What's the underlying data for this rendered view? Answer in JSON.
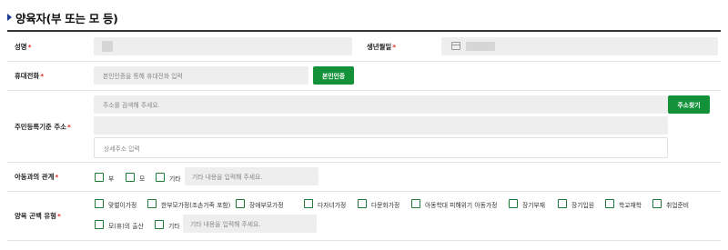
{
  "section": {
    "title": "양육자(부 또는 모 등)",
    "marker_icon": "triangle-right-icon",
    "marker_color": "#1a3a8f"
  },
  "fields": {
    "name": {
      "label": "성명",
      "required_mark": "*"
    },
    "birth": {
      "label": "생년월일",
      "required_mark": "*",
      "icon": "calendar-icon"
    },
    "phone": {
      "label": "휴대전화",
      "required_mark": "*",
      "placeholder": "본인인증을 통해 휴대전화 입력",
      "button": "본인인증"
    },
    "address": {
      "label": "주민등록기준 주소",
      "required_mark": "*",
      "placeholder": "주소를 검색해 주세요.",
      "button": "주소찾기",
      "detail_placeholder": "상세주소 입력"
    },
    "relation": {
      "label": "아동과의 관계",
      "required_mark": "*",
      "options": [
        "부",
        "모",
        "기타"
      ],
      "other_placeholder": "기타 내용을 입력해 주세요."
    },
    "type": {
      "label": "양육 곤백 유형",
      "required_mark": "*",
      "options": [
        "맞벌이가정",
        "한부모가정(조손가족 포함)",
        "장애부모가정",
        "다자녀가정",
        "다문화가정",
        "아동학대 피해위기 아동가정",
        "장기부재",
        "장기입원",
        "학교재학",
        "취업준비",
        "모(휴)의 출산",
        "기타"
      ],
      "other_placeholder": "기타 내용을 입력해 주세요."
    }
  },
  "colors": {
    "accent_green": "#14923a",
    "required_red": "#e0241b",
    "input_gray": "#eeeeee"
  }
}
